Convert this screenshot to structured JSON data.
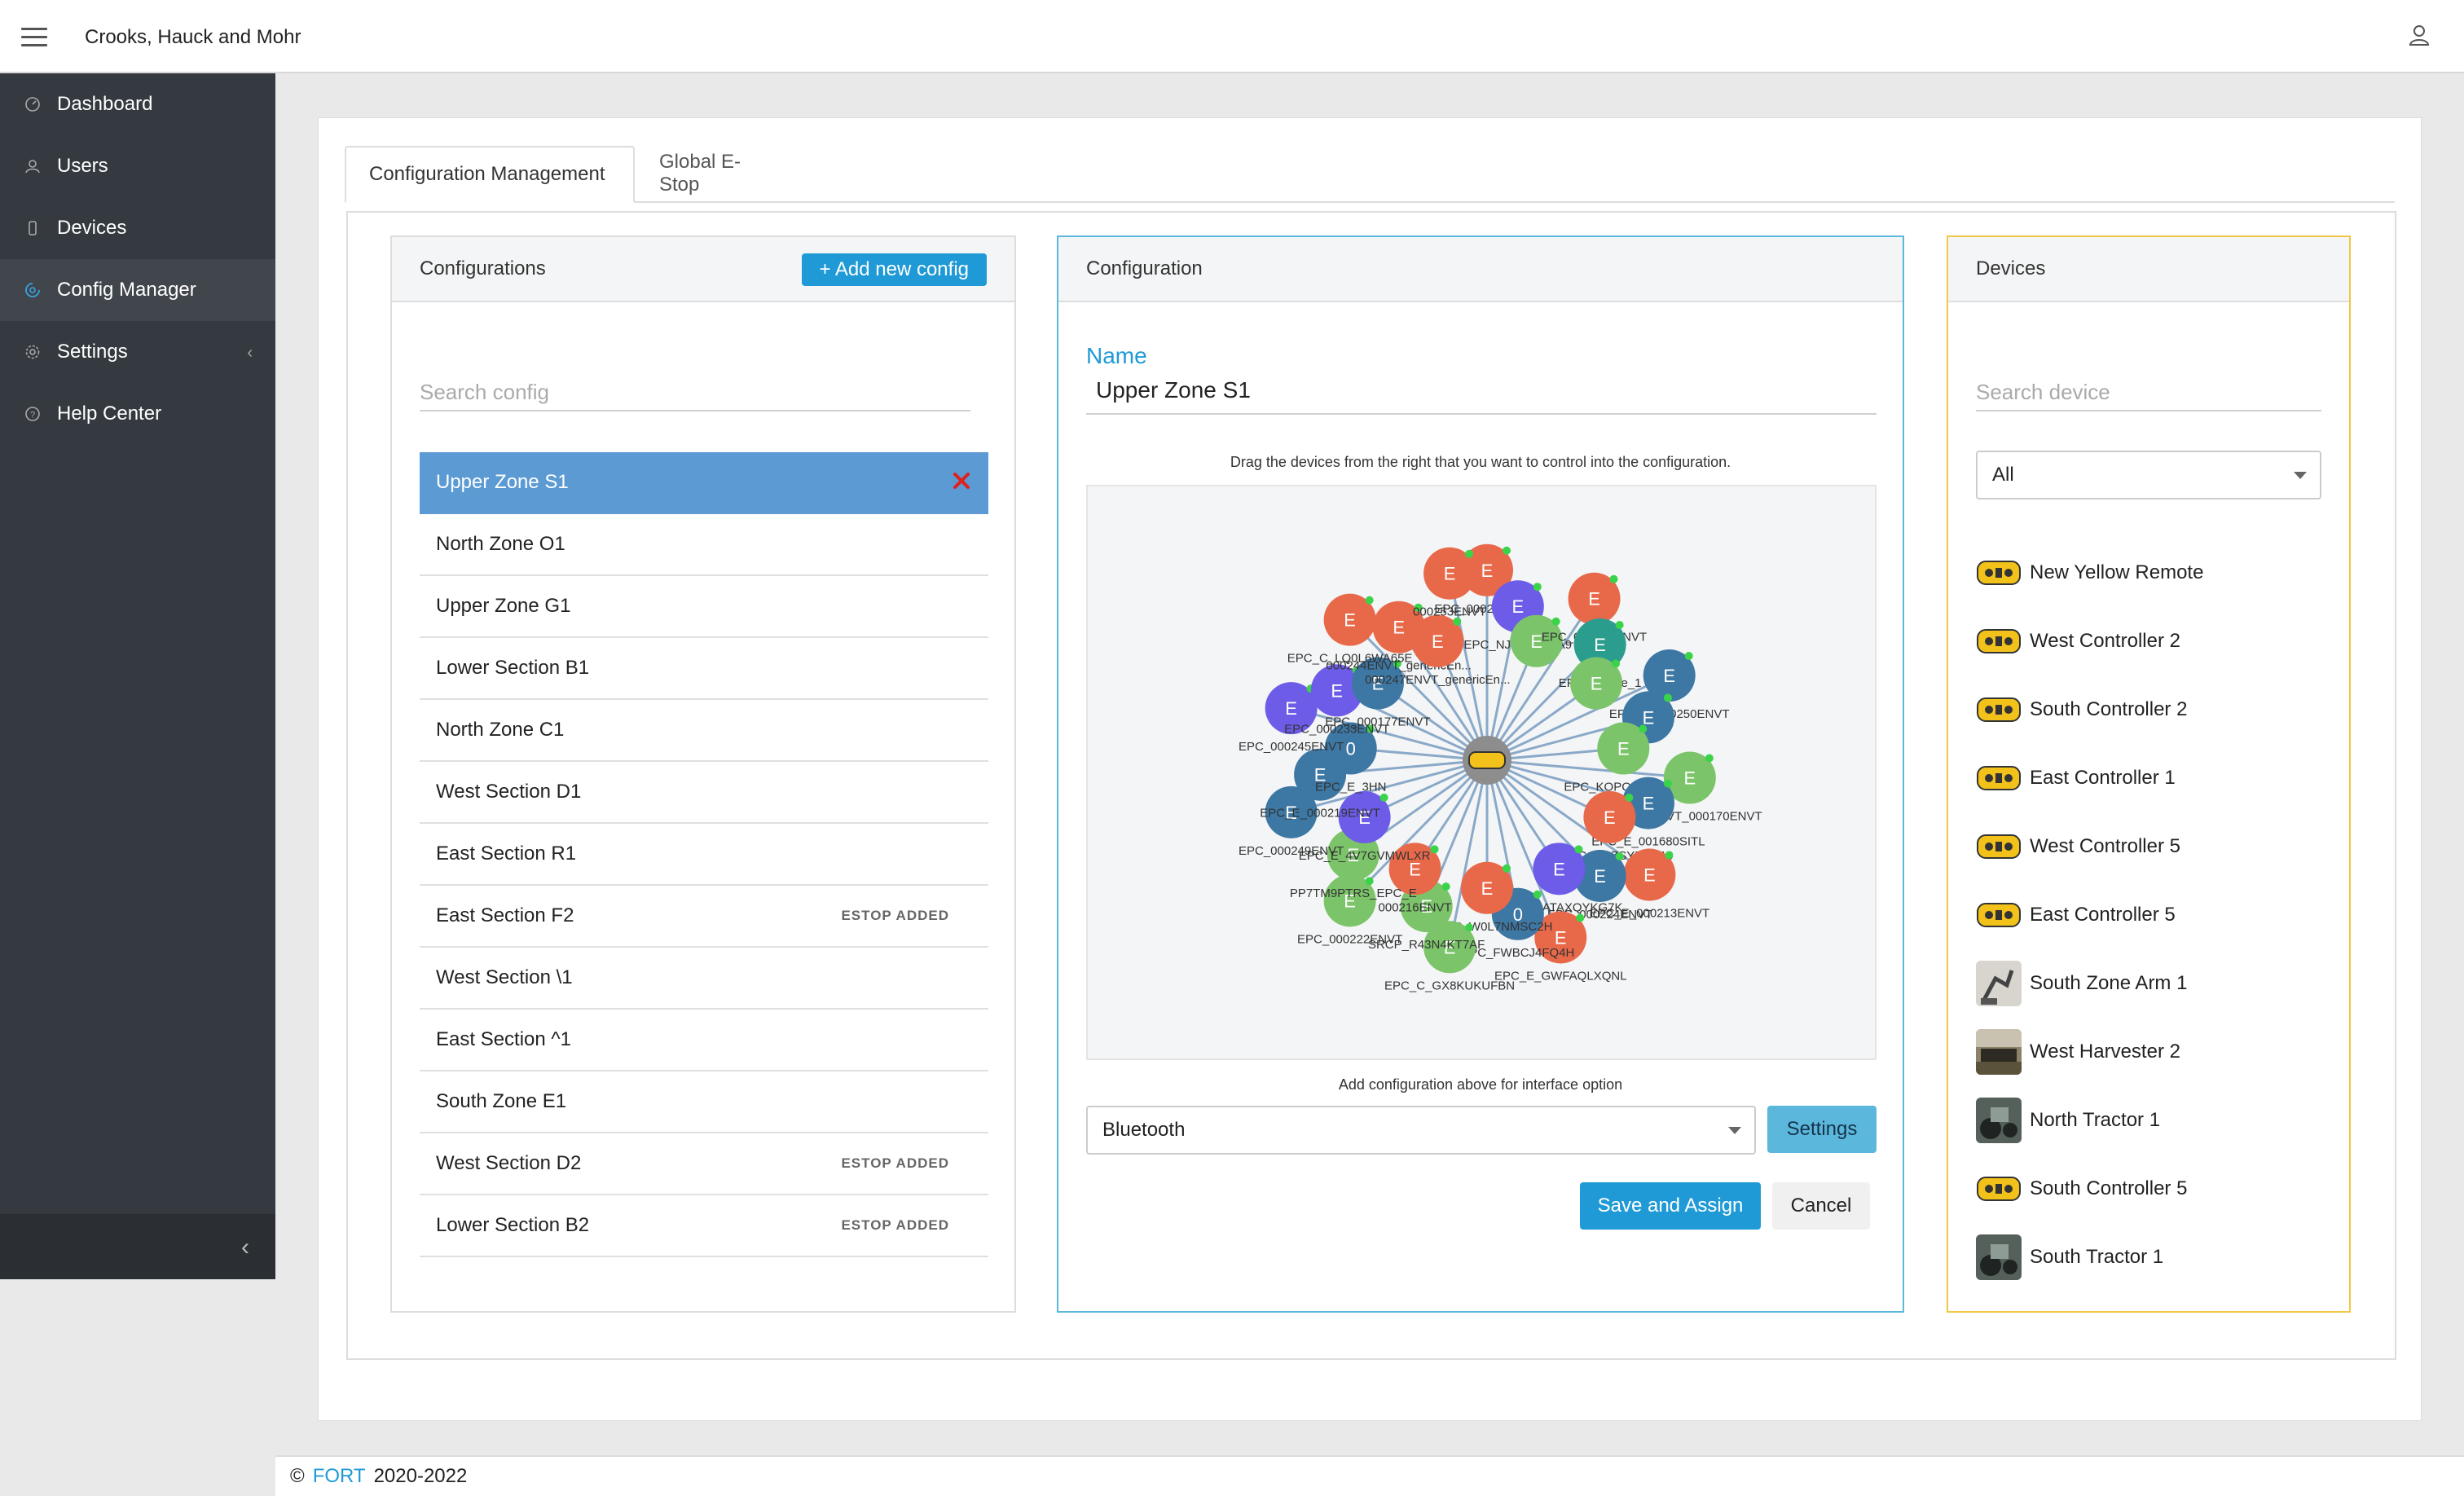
{
  "app": {
    "company": "Crooks, Hauck and Mohr"
  },
  "sidebar": {
    "items": [
      {
        "label": "Dashboard",
        "icon": "dashboard-icon"
      },
      {
        "label": "Users",
        "icon": "user-icon"
      },
      {
        "label": "Devices",
        "icon": "device-icon"
      },
      {
        "label": "Config Manager",
        "icon": "config-icon"
      },
      {
        "label": "Settings",
        "icon": "gear-icon"
      },
      {
        "label": "Help Center",
        "icon": "help-icon"
      }
    ]
  },
  "tabs": [
    {
      "label": "Configuration Management"
    },
    {
      "label": "Global E-Stop"
    }
  ],
  "configurations": {
    "title": "Configurations",
    "add_label": "+ Add new config",
    "search_placeholder": "Search config",
    "items": [
      {
        "label": "Upper Zone S1",
        "badge": ""
      },
      {
        "label": "North Zone O1",
        "badge": ""
      },
      {
        "label": "Upper Zone G1",
        "badge": ""
      },
      {
        "label": "Lower Section B1",
        "badge": ""
      },
      {
        "label": "North Zone C1",
        "badge": ""
      },
      {
        "label": "West Section D1",
        "badge": ""
      },
      {
        "label": "East Section R1",
        "badge": ""
      },
      {
        "label": "East Section F2",
        "badge": "ESTOP ADDED"
      },
      {
        "label": "West Section \\1",
        "badge": ""
      },
      {
        "label": "East Section ^1",
        "badge": ""
      },
      {
        "label": "South Zone E1",
        "badge": ""
      },
      {
        "label": "West Section D2",
        "badge": "ESTOP ADDED"
      },
      {
        "label": "Lower Section B2",
        "badge": "ESTOP ADDED"
      }
    ]
  },
  "configuration": {
    "title": "Configuration",
    "name_label": "Name",
    "name_value": "Upper Zone S1",
    "drag_hint": "Drag the devices from the right that you want to control into the configuration.",
    "add_hint": "Add configuration above for interface option",
    "interface_value": "Bluetooth",
    "settings_label": "Settings",
    "save_label": "Save and Assign",
    "cancel_label": "Cancel",
    "graph_nodes": [
      {
        "letter": "E",
        "label": "EPC_000229ENVT",
        "color": "#e8694a"
      },
      {
        "letter": "E",
        "label": "EPC_NJEKWMAA9",
        "color": "#6c5ce7"
      },
      {
        "letter": "E",
        "label": "",
        "color": "#7cc46a"
      },
      {
        "letter": "E",
        "label": "EPC_000252ENVT",
        "color": "#e8694a"
      },
      {
        "letter": "E",
        "label": "EPC_Device_1",
        "color": "#2a9d8f"
      },
      {
        "letter": "E",
        "label": "",
        "color": "#7cc46a"
      },
      {
        "letter": "E",
        "label": "EPC_E_000250ENVT",
        "color": "#3d77a3"
      },
      {
        "letter": "E",
        "label": "",
        "color": "#3d77a3"
      },
      {
        "letter": "E",
        "label": "EPC_KOPOMPLHCD",
        "color": "#7cc46a"
      },
      {
        "letter": "E",
        "label": "EPC_ENVT_000170ENVT",
        "color": "#7cc46a"
      },
      {
        "letter": "E",
        "label": "EPC_E_001680SITL",
        "color": "#3d77a3"
      },
      {
        "letter": "E",
        "label": "EPC_C_RCZSYRSY19",
        "color": "#e8694a"
      },
      {
        "letter": "E",
        "label": "EPC_E_000213ENVT",
        "color": "#e8694a"
      },
      {
        "letter": "E",
        "label": "EPC_000224ENVT",
        "color": "#3d77a3"
      },
      {
        "letter": "E",
        "label": "EPC_E_ATAXQYKG7K",
        "color": "#6c5ce7"
      },
      {
        "letter": "E",
        "label": "EPC_E_GWFAQLXQNL",
        "color": "#e8694a"
      },
      {
        "letter": "0",
        "label": "EPC_FWBCJ4FQ4H",
        "color": "#3d77a3"
      },
      {
        "letter": "E",
        "label": "EPC_C_W0L7NMSC2H",
        "color": "#e8694a"
      },
      {
        "letter": "E",
        "label": "EPC_C_GX8KUKUFBN",
        "color": "#7cc46a"
      },
      {
        "letter": "E",
        "label": "SRCP_R43N4KT7AF",
        "color": "#7cc46a"
      },
      {
        "letter": "E",
        "label": "000216ENVT",
        "color": "#e8694a"
      },
      {
        "letter": "E",
        "label": "EPC_000222ENVT",
        "color": "#7cc46a"
      },
      {
        "letter": "E",
        "label": "PP7TM9PTRS_EPC_E",
        "color": "#7cc46a"
      },
      {
        "letter": "E",
        "label": "EPC_E_4V7GVMWLXR",
        "color": "#6c5ce7"
      },
      {
        "letter": "E",
        "label": "EPC_000249ENVT",
        "color": "#3d77a3"
      },
      {
        "letter": "E",
        "label": "EPC_E_000219ENVT",
        "color": "#3d77a3"
      },
      {
        "letter": "0",
        "label": "EPC_E_3HN",
        "color": "#3d77a3"
      },
      {
        "letter": "E",
        "label": "EPC_000245ENVT",
        "color": "#6c5ce7"
      },
      {
        "letter": "E",
        "label": "EPC_000233ENVT",
        "color": "#6c5ce7"
      },
      {
        "letter": "E",
        "label": "EPC_000177ENVT",
        "color": "#3d77a3"
      },
      {
        "letter": "E",
        "label": "EPC_C_LQ0L6WA65E",
        "color": "#e8694a"
      },
      {
        "letter": "E",
        "label": "000244ENVT_genericEn...",
        "color": "#e8694a"
      },
      {
        "letter": "E",
        "label": "000247ENVT_genericEn...",
        "color": "#e8694a"
      },
      {
        "letter": "E",
        "label": "000253ENVT",
        "color": "#e8694a"
      }
    ]
  },
  "devices": {
    "title": "Devices",
    "search_placeholder": "Search device",
    "filter_value": "All",
    "items": [
      {
        "label": "New Yellow Remote",
        "thumb": "remote"
      },
      {
        "label": "West Controller 2",
        "thumb": "remote"
      },
      {
        "label": "South Controller 2",
        "thumb": "remote"
      },
      {
        "label": "East Controller 1",
        "thumb": "remote"
      },
      {
        "label": "West Controller 5",
        "thumb": "remote"
      },
      {
        "label": "East Controller 5",
        "thumb": "remote"
      },
      {
        "label": "South Zone Arm 1",
        "thumb": "arm"
      },
      {
        "label": "West Harvester 2",
        "thumb": "harvester"
      },
      {
        "label": "North Tractor 1",
        "thumb": "tractor"
      },
      {
        "label": "South Controller 5",
        "thumb": "remote"
      },
      {
        "label": "South Tractor 1",
        "thumb": "tractor"
      }
    ]
  },
  "footer": {
    "copyright": "©",
    "brand": "FORT",
    "years": "2020-2022"
  },
  "colors": {
    "accent": "#1f9ad6",
    "selected_row": "#5b9ad3",
    "sidebar": "#353a40",
    "config_border": "#5bb8dc",
    "devices_border": "#f2c744"
  }
}
